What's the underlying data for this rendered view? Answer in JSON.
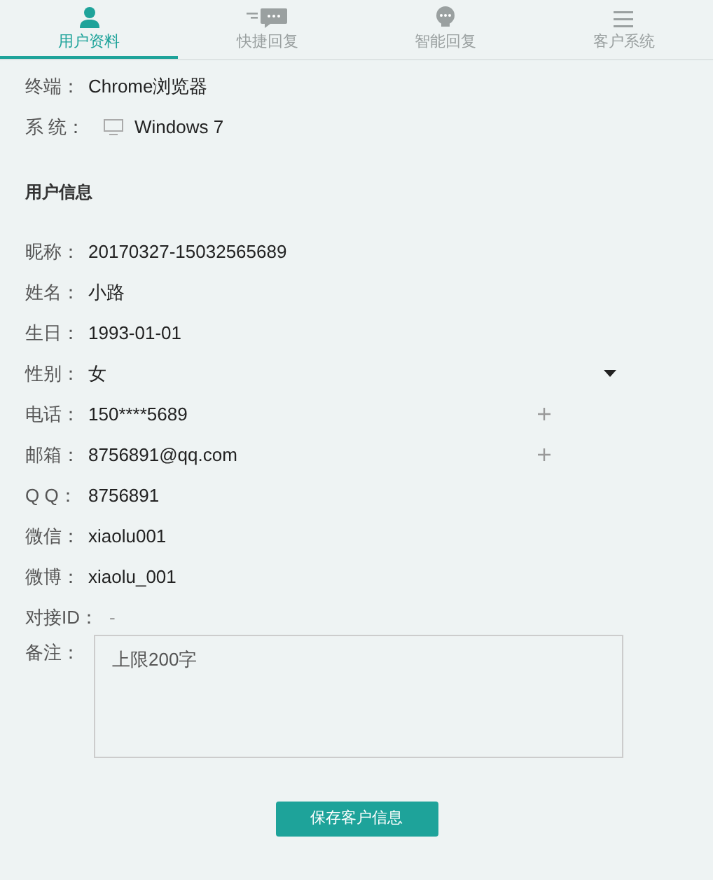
{
  "tabs": [
    {
      "label": "用户资料",
      "kind": "person",
      "selected": true
    },
    {
      "label": "快捷回复",
      "kind": "chat",
      "selected": false
    },
    {
      "label": "智能回复",
      "kind": "bubble",
      "selected": false
    },
    {
      "label": "客户系统",
      "kind": "menu",
      "selected": false
    }
  ],
  "device": [
    {
      "label": "终端：",
      "value": "Chrome浏览器",
      "kind": "text"
    },
    {
      "label": "系 统：",
      "value": "Windows 7",
      "kind": "monitor"
    }
  ],
  "section_title": "用户信息",
  "fields": [
    {
      "label": "昵称：",
      "value": "20170327-15032565689",
      "kind": "text"
    },
    {
      "label": "姓名：",
      "value": "小路",
      "kind": "text"
    },
    {
      "label": "生日：",
      "value": "1993-01-01",
      "kind": "text"
    },
    {
      "label": "性别：",
      "value": "女",
      "kind": "select"
    },
    {
      "label": "电话：",
      "value": "150****5689",
      "kind": "add"
    },
    {
      "label": "邮箱：",
      "value": "8756891@qq.com",
      "kind": "add"
    },
    {
      "label": "Q Q：",
      "value": "8756891",
      "kind": "text"
    },
    {
      "label": "微信：",
      "value": "xiaolu001",
      "kind": "text"
    },
    {
      "label": "微博：",
      "value": "xiaolu_001",
      "kind": "text"
    },
    {
      "label": "对接ID：",
      "value": "-",
      "kind": "muted"
    }
  ],
  "note": {
    "label": "备注：",
    "placeholder": "上限200字"
  },
  "save_button": "保存客户信息"
}
